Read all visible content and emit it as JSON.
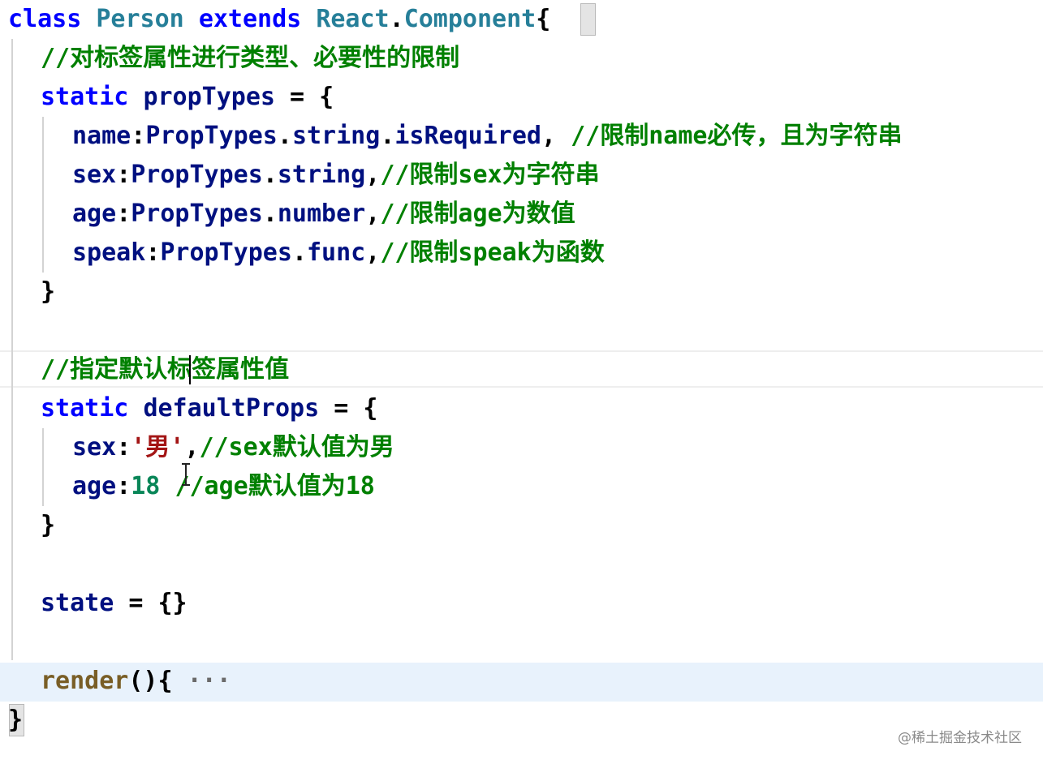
{
  "editor": {
    "lines": [
      {
        "tokens": [
          {
            "t": "class ",
            "c": "kw"
          },
          {
            "t": "Person ",
            "c": "cls"
          },
          {
            "t": "extends ",
            "c": "kw"
          },
          {
            "t": "React",
            "c": "cls"
          },
          {
            "t": ".",
            "c": "punc"
          },
          {
            "t": "Component",
            "c": "cls"
          },
          {
            "t": "{",
            "c": "punc"
          }
        ]
      },
      {
        "tokens": [
          {
            "t": "//对标签属性进行类型、必要性的限制",
            "c": "cmt"
          }
        ]
      },
      {
        "tokens": [
          {
            "t": "static ",
            "c": "kw"
          },
          {
            "t": "propTypes",
            "c": "prop"
          },
          {
            "t": " = {",
            "c": "punc"
          }
        ]
      },
      {
        "tokens": [
          {
            "t": "name",
            "c": "prop"
          },
          {
            "t": ":",
            "c": "punc"
          },
          {
            "t": "PropTypes",
            "c": "prop"
          },
          {
            "t": ".",
            "c": "punc"
          },
          {
            "t": "string",
            "c": "prop"
          },
          {
            "t": ".",
            "c": "punc"
          },
          {
            "t": "isRequired",
            "c": "prop"
          },
          {
            "t": ", ",
            "c": "punc"
          },
          {
            "t": "//限制name必传，且为字符串",
            "c": "cmt"
          }
        ]
      },
      {
        "tokens": [
          {
            "t": "sex",
            "c": "prop"
          },
          {
            "t": ":",
            "c": "punc"
          },
          {
            "t": "PropTypes",
            "c": "prop"
          },
          {
            "t": ".",
            "c": "punc"
          },
          {
            "t": "string",
            "c": "prop"
          },
          {
            "t": ",",
            "c": "punc"
          },
          {
            "t": "//限制sex为字符串",
            "c": "cmt"
          }
        ]
      },
      {
        "tokens": [
          {
            "t": "age",
            "c": "prop"
          },
          {
            "t": ":",
            "c": "punc"
          },
          {
            "t": "PropTypes",
            "c": "prop"
          },
          {
            "t": ".",
            "c": "punc"
          },
          {
            "t": "number",
            "c": "prop"
          },
          {
            "t": ",",
            "c": "punc"
          },
          {
            "t": "//限制age为数值",
            "c": "cmt"
          }
        ]
      },
      {
        "tokens": [
          {
            "t": "speak",
            "c": "prop"
          },
          {
            "t": ":",
            "c": "punc"
          },
          {
            "t": "PropTypes",
            "c": "prop"
          },
          {
            "t": ".",
            "c": "punc"
          },
          {
            "t": "func",
            "c": "prop"
          },
          {
            "t": ",",
            "c": "punc"
          },
          {
            "t": "//限制speak为函数",
            "c": "cmt"
          }
        ]
      },
      {
        "tokens": [
          {
            "t": "}",
            "c": "punc"
          }
        ]
      },
      {
        "tokens": []
      },
      {
        "tokens": [
          {
            "t": "//指定默认标签属性值",
            "c": "cmt"
          }
        ]
      },
      {
        "tokens": [
          {
            "t": "static ",
            "c": "kw"
          },
          {
            "t": "defaultProps",
            "c": "prop"
          },
          {
            "t": " = {",
            "c": "punc"
          }
        ]
      },
      {
        "tokens": [
          {
            "t": "sex",
            "c": "prop"
          },
          {
            "t": ":",
            "c": "punc"
          },
          {
            "t": "'男'",
            "c": "str"
          },
          {
            "t": ",",
            "c": "punc"
          },
          {
            "t": "//sex默认值为男",
            "c": "cmt"
          }
        ]
      },
      {
        "tokens": [
          {
            "t": "age",
            "c": "prop"
          },
          {
            "t": ":",
            "c": "punc"
          },
          {
            "t": "18",
            "c": "num"
          },
          {
            "t": " ",
            "c": "punc"
          },
          {
            "t": "//age默认值为18",
            "c": "cmt"
          }
        ]
      },
      {
        "tokens": [
          {
            "t": "}",
            "c": "punc"
          }
        ]
      },
      {
        "tokens": []
      },
      {
        "tokens": [
          {
            "t": "state",
            "c": "prop"
          },
          {
            "t": " = {}",
            "c": "punc"
          }
        ]
      },
      {
        "tokens": []
      },
      {
        "tokens": [
          {
            "t": "render",
            "c": "fn"
          },
          {
            "t": "(){",
            "c": "punc"
          },
          {
            "t": " ···",
            "c": "fold"
          }
        ]
      },
      {
        "tokens": [
          {
            "t": "}",
            "c": "punc"
          }
        ]
      }
    ]
  },
  "watermark": "@稀土掘金技术社区"
}
